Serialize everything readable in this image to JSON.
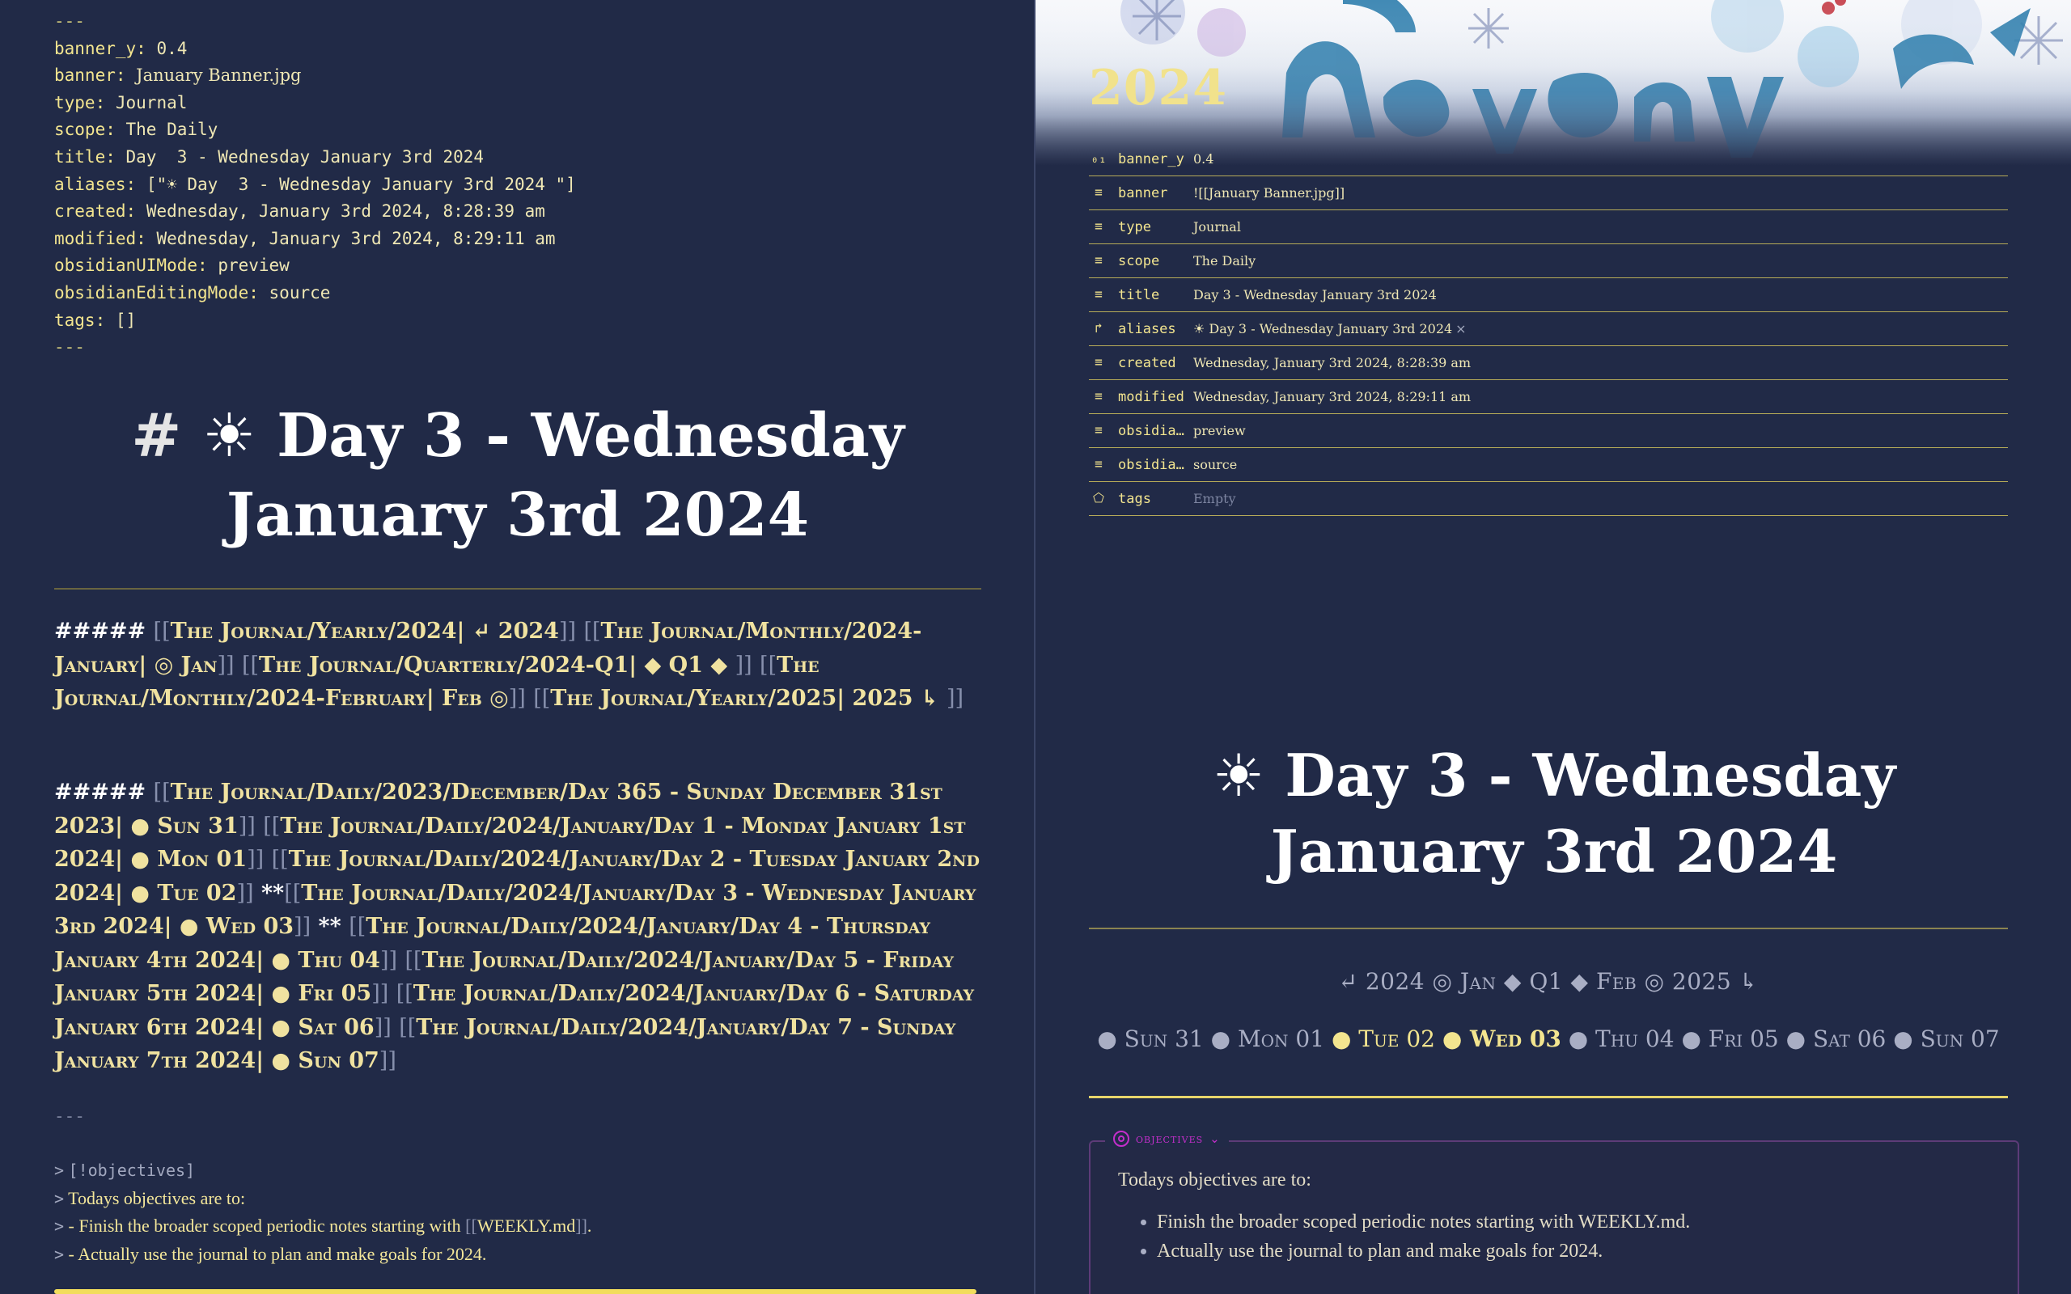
{
  "frontmatter": {
    "delim": "---",
    "lines": [
      {
        "key": "banner_y:",
        "value": "0.4",
        "serif": false
      },
      {
        "key": "banner:",
        "value": "January Banner.jpg",
        "serif": true
      },
      {
        "key": "type:",
        "value": "Journal",
        "serif": false
      },
      {
        "key": "scope:",
        "value": "The Daily",
        "serif": false
      },
      {
        "key": "title:",
        "value": "Day  3 - Wednesday January 3rd 2024",
        "serif": false
      },
      {
        "key": "aliases:",
        "value": "[\"☀ Day  3 - Wednesday January 3rd 2024 \"]",
        "serif": false
      },
      {
        "key": "created:",
        "value": "Wednesday, January 3rd 2024, 8:28:39 am",
        "serif": false
      },
      {
        "key": "modified:",
        "value": "Wednesday, January 3rd 2024, 8:29:11 am",
        "serif": false
      },
      {
        "key": "obsidianUIMode:",
        "value": "preview",
        "serif": false
      },
      {
        "key": "obsidianEditingMode:",
        "value": "source",
        "serif": false
      },
      {
        "key": "tags:",
        "value": "[]",
        "serif": false
      }
    ]
  },
  "source": {
    "h1_hash": "#",
    "h1_text": "☀ Day 3 - Wednesday January 3rd 2024",
    "nav1": {
      "prefix": "#####",
      "links": [
        "The Journal/Yearly/2024| ↵ 2024",
        "The Journal/Monthly/2024-January| ◎ Jan",
        "The Journal/Quarterly/2024-Q1| ◆ Q1 ◆ ",
        "The Journal/Monthly/2024-February| Feb ◎",
        "The Journal/Yearly/2025| 2025 ↳ "
      ]
    },
    "nav2": {
      "prefix": "#####",
      "links_before": [
        "The Journal/Daily/2023/December/Day  365 - Sunday December 31st 2023| ● Sun 31",
        "The Journal/Daily/2024/January/Day  1 - Monday January 1st 2024| ● Mon 01",
        "The Journal/Daily/2024/January/Day  2 - Tuesday January 2nd 2024| ● Tue 02"
      ],
      "bold_marker": "**",
      "current": "The Journal/Daily/2024/January/Day  3 - Wednesday January 3rd 2024| ● Wed 03",
      "links_after": [
        "The Journal/Daily/2024/January/Day  4 - Thursday January 4th 2024| ● Thu 04",
        "The Journal/Daily/2024/January/Day  5 - Friday January 5th 2024| ● Fri 05",
        "The Journal/Daily/2024/January/Day  6 - Saturday January 6th 2024| ● Sat 06",
        "The Journal/Daily/2024/January/Day  7 - Sunday January 7th 2024| ● Sun 07"
      ]
    },
    "hr": "---",
    "callout": {
      "quote": ">",
      "type_line": "[!objectives]",
      "intro": "Todays objectives are to:",
      "bullet1_pre": "- Finish the broader scoped periodic notes starting with ",
      "bullet1_link": "WEEKLY.md",
      "bullet1_post": ".",
      "bullet2": "- Actually use the journal to plan and make goals for 2024."
    }
  },
  "preview": {
    "year": "2024",
    "properties": [
      {
        "icon": "number-icon",
        "glyph": "₀₁",
        "key": "banner_y",
        "value": "0.4"
      },
      {
        "icon": "text-icon",
        "glyph": "≡",
        "key": "banner",
        "value": "![[January Banner.jpg]]"
      },
      {
        "icon": "text-icon",
        "glyph": "≡",
        "key": "type",
        "value": "Journal"
      },
      {
        "icon": "text-icon",
        "glyph": "≡",
        "key": "scope",
        "value": "The Daily"
      },
      {
        "icon": "text-icon",
        "glyph": "≡",
        "key": "title",
        "value": "Day  3 - Wednesday January 3rd 2024"
      },
      {
        "icon": "alias-icon",
        "glyph": "↱",
        "key": "aliases",
        "value": "☀ Day  3 - Wednesday January 3rd 2024",
        "removable": "×"
      },
      {
        "icon": "text-icon",
        "glyph": "≡",
        "key": "created",
        "value": "Wednesday, January 3rd 2024, 8:28:39 am"
      },
      {
        "icon": "text-icon",
        "glyph": "≡",
        "key": "modified",
        "value": "Wednesday, January 3rd 2024, 8:29:11 am"
      },
      {
        "icon": "text-icon",
        "glyph": "≡",
        "key": "obsidia…",
        "value": "preview"
      },
      {
        "icon": "text-icon",
        "glyph": "≡",
        "key": "obsidia…",
        "value": "source"
      },
      {
        "icon": "tag-icon",
        "glyph": "⬠",
        "key": "tags",
        "value": "Empty",
        "empty": true
      }
    ],
    "h1": "☀ Day 3 - Wednesday January 3rd 2024",
    "nav1": [
      "↵ 2024",
      "◎ Jan",
      "◆ Q1 ◆",
      "Feb ◎",
      "2025 ↳"
    ],
    "nav2": [
      {
        "label": "● Sun 31",
        "state": "normal"
      },
      {
        "label": "● Mon 01",
        "state": "normal"
      },
      {
        "label": "● Tue 02",
        "state": "recent"
      },
      {
        "label": "● Wed 03",
        "state": "current"
      },
      {
        "label": "● Thu 04",
        "state": "normal"
      },
      {
        "label": "● Fri 05",
        "state": "normal"
      },
      {
        "label": "● Sat 06",
        "state": "normal"
      },
      {
        "label": "● Sun 07",
        "state": "normal"
      }
    ],
    "callout": {
      "title": "objectives",
      "intro": "Todays objectives are to:",
      "items": [
        "Finish the broader scoped periodic notes starting with WEEKLY.md.",
        "Actually use the journal to plan and make goals for 2024."
      ]
    }
  }
}
